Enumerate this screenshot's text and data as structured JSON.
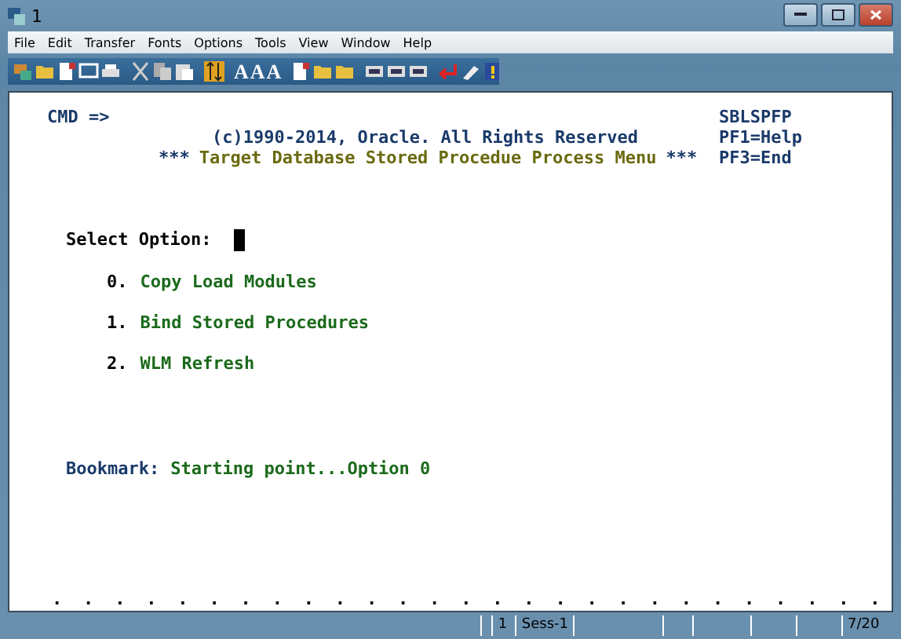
{
  "window": {
    "title": "1"
  },
  "menu": [
    "File",
    "Edit",
    "Transfer",
    "Fonts",
    "Options",
    "Tools",
    "View",
    "Window",
    "Help"
  ],
  "toolbar": [
    {
      "kind": "icon",
      "selected": false
    },
    {
      "kind": "icon",
      "selected": false
    },
    {
      "kind": "icon",
      "selected": false
    },
    {
      "kind": "icon",
      "selected": false
    },
    {
      "kind": "icon",
      "selected": false
    },
    {
      "kind": "sep"
    },
    {
      "kind": "icon",
      "selected": false
    },
    {
      "kind": "icon",
      "selected": false
    },
    {
      "kind": "icon",
      "selected": false
    },
    {
      "kind": "sep"
    },
    {
      "kind": "icon",
      "selected": true
    },
    {
      "kind": "sep"
    },
    {
      "kind": "glyph",
      "glyph": "A",
      "selected": false
    },
    {
      "kind": "glyph",
      "glyph": "A",
      "selected": false
    },
    {
      "kind": "glyph",
      "glyph": "A",
      "selected": false
    },
    {
      "kind": "sep"
    },
    {
      "kind": "icon",
      "selected": false
    },
    {
      "kind": "icon",
      "selected": false
    },
    {
      "kind": "icon",
      "selected": false
    },
    {
      "kind": "sep"
    },
    {
      "kind": "icon",
      "selected": false
    },
    {
      "kind": "icon",
      "selected": false
    },
    {
      "kind": "icon",
      "selected": false
    },
    {
      "kind": "sep"
    },
    {
      "kind": "icon",
      "selected": false
    },
    {
      "kind": "icon",
      "selected": false
    },
    {
      "kind": "icon",
      "selected": false
    }
  ],
  "terminal": {
    "cmd_label": "CMD =>",
    "screen_id": "SBLSPFP",
    "copyright": "(c)1990-2014, Oracle. All Rights Reserved",
    "pf1": "PF1=Help",
    "title_stars_left": "***",
    "title": "Target Database Stored Procedue Process Menu",
    "title_stars_right": "***",
    "pf3": "PF3=End",
    "select_label": "Select Option:",
    "options": [
      {
        "number": "0.",
        "label": "Copy Load Modules"
      },
      {
        "number": "1.",
        "label": "Bind Stored Procedures"
      },
      {
        "number": "2.",
        "label": "WLM Refresh"
      }
    ],
    "bookmark_label": "Bookmark:",
    "bookmark_value": "Starting point...Option 0",
    "ruler": ". . . . . . . . . . . . . . . . . . . . . . . . . . ."
  },
  "status_bar": {
    "fields": [
      "1",
      "Sess-1",
      "7/20"
    ]
  }
}
